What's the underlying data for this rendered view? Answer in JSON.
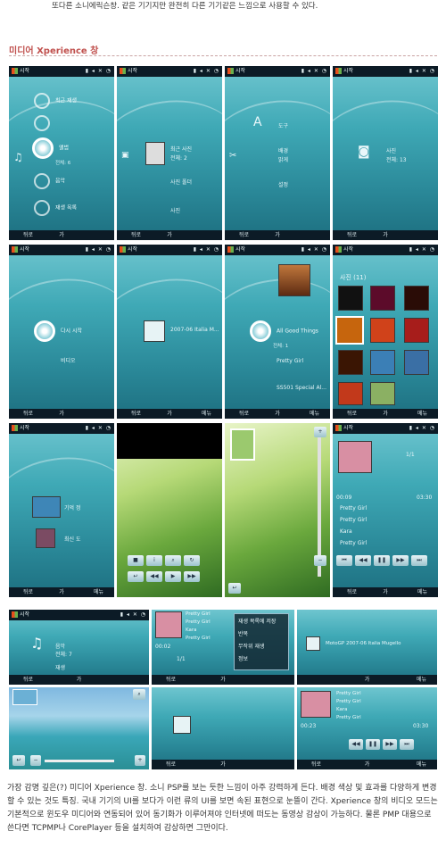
{
  "intro_text": "또다른 소니에릭슨창. 같은 기기지만 완전히 다른 기기같은 느낌으로 사용할 수 있다.",
  "section_title": "미디어 Xperience 창",
  "status": {
    "start": "시작"
  },
  "softkeys": {
    "back": "뒤로",
    "middle": "가",
    "menu": "메뉴"
  },
  "screens": {
    "main_menu": {
      "items": [
        "최근 재생",
        "앨범",
        "음악",
        "재생 목록"
      ],
      "selected_label": "앨범",
      "selected_sub": "전체: 6"
    },
    "photo_menu": {
      "items": [
        "최근 사진",
        "사진 폴더",
        "사진"
      ],
      "selected_label": "최근 사진",
      "selected_sub": "전체: 2"
    },
    "settings_menu": {
      "items": [
        "도구",
        "배경",
        "설정"
      ],
      "selected_label": "배경",
      "selected_sub": "밝게"
    },
    "camera_menu": {
      "selected_label": "사진",
      "selected_sub": "전체: 13"
    },
    "video_menu": {
      "items": [
        "다시 시작",
        "비디오"
      ]
    },
    "video_item": {
      "title": "2007-06 Italia M..."
    },
    "album_list": {
      "album": "All Good Things",
      "album_sub": "전체: 1",
      "tracks": [
        "Pretty Girl",
        "SS501 Special Al..."
      ]
    },
    "photo_grid": {
      "title": "사진 (11)"
    },
    "photo_folder": {
      "items": [
        "기억 정",
        "최신 도"
      ]
    },
    "player": {
      "tracks": [
        "Pretty Girl",
        "Pretty Girl",
        "Kara",
        "Pretty Girl"
      ],
      "time_elapsed": "00:09",
      "time_total": "03:30",
      "track_pos": "1/1"
    },
    "music_menu": {
      "item": "음악",
      "sub": "전체: 7",
      "other": "재생"
    },
    "player_menu": {
      "menu_items": [
        "재생 목록에 저장",
        "반복",
        "무작위 재생",
        "정보"
      ],
      "time": "00:02"
    },
    "video_file": {
      "title": "MotoGP 2007-06 Italia Mugello"
    },
    "player_small": {
      "tracks": [
        "Pretty Girl",
        "Pretty Girl",
        "Kara",
        "Pretty Girl"
      ],
      "time_elapsed": "00:23",
      "time_total": "03:30"
    }
  },
  "caption": "가장 감명 깊은(?) 미디어 Xperience 창. 소니 PSP를 보는 듯한 느낌이 아주 강력하게 든다. 배경 색상 및 효과를 다양하게 변경할 수 있는 것도 특징. 국내 기기의 UI를 보다가 이런 류의 UI를 보면 속된 표현으로 눈뜰이 간다. Xperience 창의 비디오 모드는 기본적으로 윈도우 미디어와 연동되어 있어 동기화가 이루어져야 인터넷에 떠도는 동영상 감상이 가능하다. 물론 PMP 대용으로 쓴다면 TCPMP나 CorePlayer 등을 설치하여 감상하면 그만이다."
}
